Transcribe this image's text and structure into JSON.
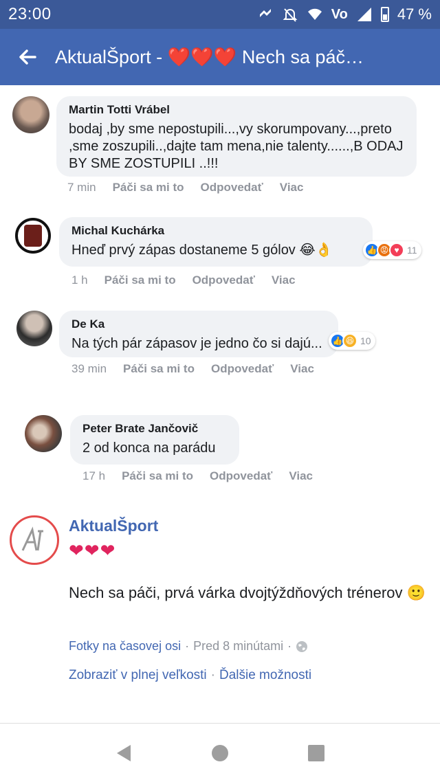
{
  "status_bar": {
    "time": "23:00",
    "battery": "47 %"
  },
  "app_bar": {
    "title": "AktualŠport - ❤️❤️❤️ Nech sa páč…"
  },
  "comments": [
    {
      "name": "Martin Totti Vrábel",
      "text": "bodaj ,by sme nepostupili...,vy skorumpovany...,preto ,sme zoszupili..,dajte tam mena,nie talenty......,B ODAJ BY SME ZOSTUPILI ..!!!",
      "time": "7 min",
      "like": "Páči sa mi to",
      "reply": "Odpovedať",
      "more": "Viac"
    },
    {
      "name": "Michal Kuchárka",
      "text": "Hneď prvý zápas dostaneme 5 gólov 😂👌",
      "reactions": "11",
      "time": "1 h",
      "like": "Páči sa mi to",
      "reply": "Odpovedať",
      "more": "Viac"
    },
    {
      "name": "De Ka",
      "text": "Na tých pár zápasov je jedno čo si dajú...",
      "reactions": "10",
      "time": "39 min",
      "like": "Páči sa mi to",
      "reply": "Odpovedať",
      "more": "Viac"
    },
    {
      "name": "Peter Brate Jančovič",
      "text": "2 od konca na parádu",
      "time": "17 h",
      "like": "Páči sa mi to",
      "reply": "Odpovedať",
      "more": "Viac"
    }
  ],
  "post": {
    "page_name": "AktualŠport",
    "hearts": "❤❤❤",
    "text": "Nech sa páči, prvá várka dvojtýždňových trénerov 🙂",
    "album": "Fotky na časovej osi",
    "time": "Pred 8 minútami",
    "view_full": "Zobraziť v plnej veľkosti",
    "more_options": "Ďalšie možnosti"
  },
  "colors": {
    "brand": "#4267b2",
    "status": "#3b5998",
    "bubble": "#f0f2f5",
    "meta": "#90949c"
  }
}
